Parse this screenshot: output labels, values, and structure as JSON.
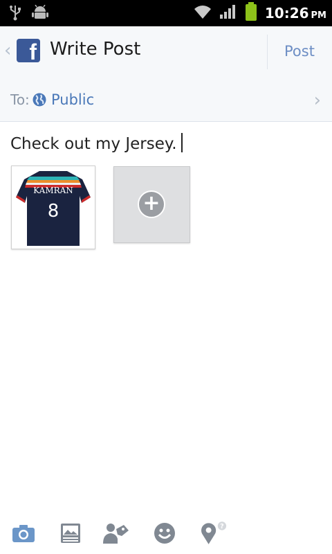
{
  "status_bar": {
    "time": "10:26",
    "ampm": "PM",
    "icons": [
      "usb-icon",
      "android-debug-icon",
      "wifi-icon",
      "signal-icon",
      "battery-icon"
    ]
  },
  "action_bar": {
    "logo": "facebook-logo",
    "title": "Write Post",
    "post_label": "Post"
  },
  "audience": {
    "to_label": "To:",
    "value": "Public"
  },
  "composer": {
    "text": "Check out my Jersey."
  },
  "attachments": {
    "photo_name": "KAMRAN",
    "photo_number": "8",
    "add_photo_icon": "plus-icon"
  },
  "toolbar": {
    "items": [
      "camera-icon",
      "photo-album-icon",
      "tag-people-icon",
      "emoticon-icon",
      "location-icon"
    ]
  },
  "colors": {
    "accent": "#4a78b8",
    "facebook_blue": "#3b5998",
    "icon_gray": "#808892"
  }
}
